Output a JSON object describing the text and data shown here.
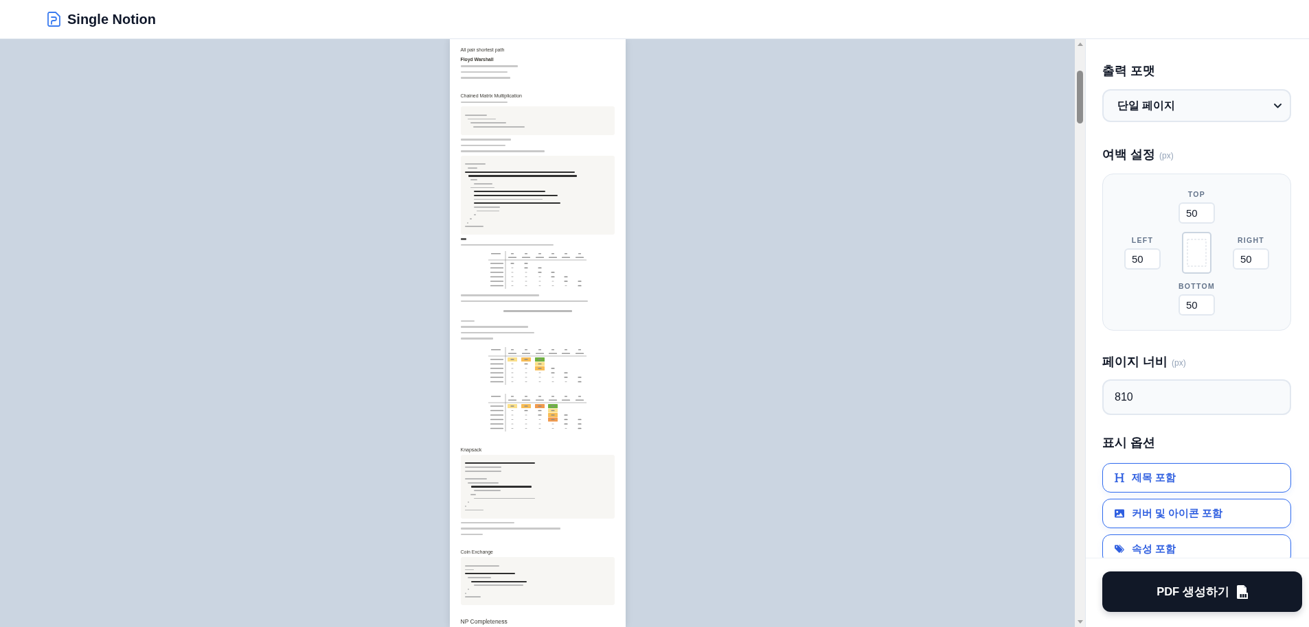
{
  "header": {
    "app_name": "Single Notion"
  },
  "preview": {
    "blocks": [
      {
        "kind": "h2",
        "text": "All pair shortest path"
      },
      {
        "kind": "h3",
        "text": "Floyd Warshall"
      },
      {
        "kind": "line"
      },
      {
        "kind": "line"
      },
      {
        "kind": "line"
      },
      {
        "kind": "h2",
        "text": "Chained Matrix Multiplication"
      },
      {
        "kind": "line"
      },
      {
        "kind": "code"
      },
      {
        "kind": "line"
      },
      {
        "kind": "line"
      },
      {
        "kind": "line"
      },
      {
        "kind": "code"
      },
      {
        "kind": "line"
      },
      {
        "kind": "line"
      },
      {
        "kind": "table"
      },
      {
        "kind": "line"
      },
      {
        "kind": "line"
      },
      {
        "kind": "formula"
      },
      {
        "kind": "line"
      },
      {
        "kind": "line"
      },
      {
        "kind": "line"
      },
      {
        "kind": "line"
      },
      {
        "kind": "table"
      },
      {
        "kind": "table"
      },
      {
        "kind": "h2",
        "text": "Knapsack"
      },
      {
        "kind": "code"
      },
      {
        "kind": "line"
      },
      {
        "kind": "line"
      },
      {
        "kind": "line"
      },
      {
        "kind": "h2",
        "text": "Coin Exchange"
      },
      {
        "kind": "code"
      },
      {
        "kind": "h1",
        "text": "NP Completeness"
      }
    ]
  },
  "settings": {
    "format": {
      "label": "출력 포맷",
      "value": "단일 페이지"
    },
    "margins": {
      "label": "여백 설정",
      "unit": "(px)",
      "top": {
        "label": "TOP",
        "value": "50"
      },
      "left": {
        "label": "LEFT",
        "value": "50"
      },
      "right": {
        "label": "RIGHT",
        "value": "50"
      },
      "bottom": {
        "label": "BOTTOM",
        "value": "50"
      }
    },
    "page_width": {
      "label": "페이지 너비",
      "unit": "(px)",
      "value": "810"
    },
    "display_options": {
      "label": "표시 옵션",
      "items": [
        {
          "label": "제목 포함",
          "on": true
        },
        {
          "label": "커버 및 아이콘 포함",
          "on": true
        },
        {
          "label": "속성 포함",
          "on": true
        }
      ]
    }
  },
  "generate_button": {
    "label": "PDF 생성하기"
  }
}
